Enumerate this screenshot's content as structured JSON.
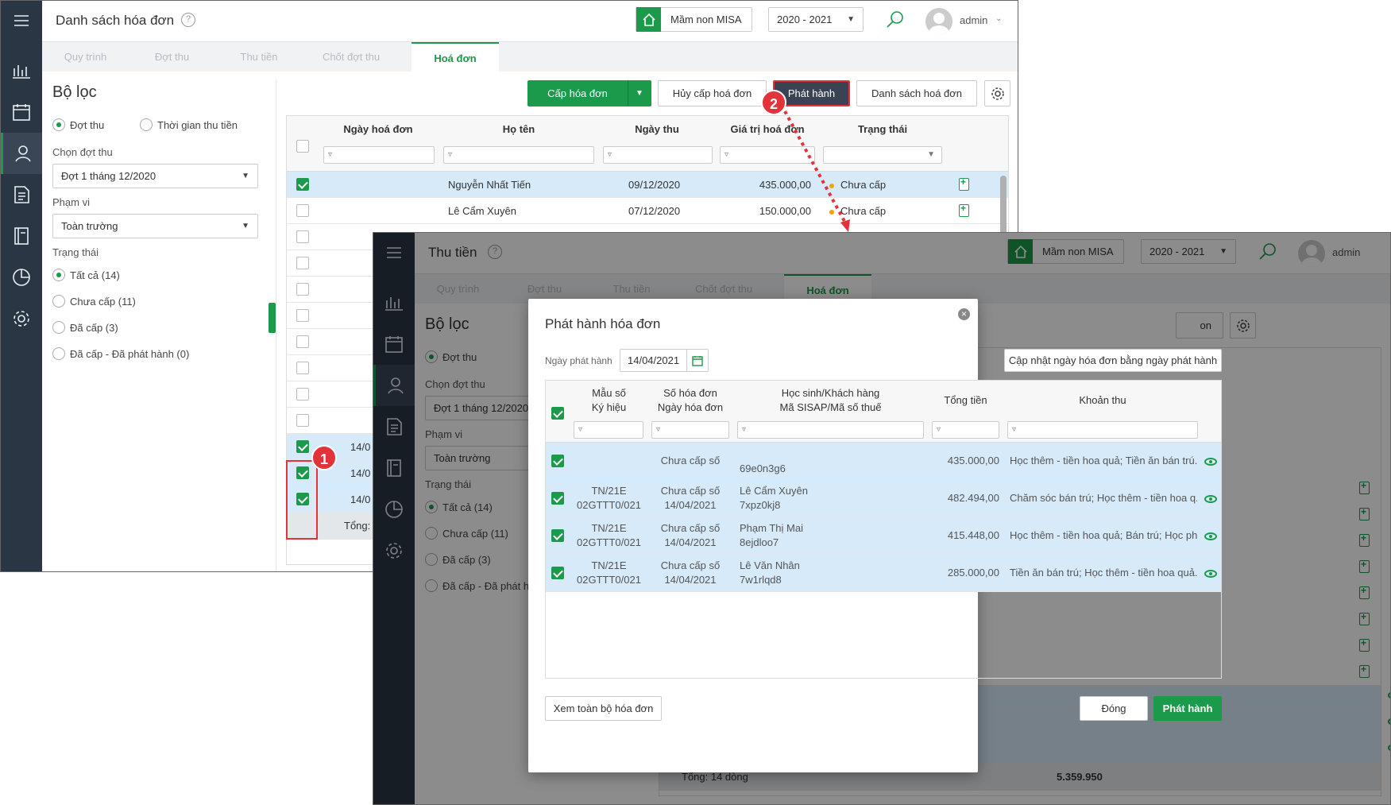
{
  "main_window": {
    "title": "Danh sách hóa đơn",
    "help": "?",
    "school": "Mầm non MISA",
    "year": "2020 - 2021",
    "user": "admin",
    "tabs": [
      "Quy trình",
      "Đợt thu",
      "Thu tiền",
      "Chốt đợt thu",
      "Hoá đơn"
    ],
    "filter": {
      "title": "Bộ lọc",
      "mode_options": [
        "Đợt thu",
        "Thời gian thu tiền"
      ],
      "period_label": "Chọn đợt thu",
      "period_value": "Đợt 1 tháng 12/2020",
      "scope_label": "Phạm vi",
      "scope_value": "Toàn trường",
      "status_label": "Trạng thái",
      "status_options": [
        "Tất cả (14)",
        "Chưa cấp (11)",
        "Đã cấp (3)",
        "Đã cấp - Đã phát hành (0)"
      ]
    },
    "toolbar": {
      "issue": "Cấp hóa đơn",
      "cancel_issue": "Hủy cấp hoá đơn",
      "publish": "Phát hành",
      "invoice_list": "Danh sách hoá đơn"
    },
    "table": {
      "columns": [
        "Ngày hoá đơn",
        "Họ tên",
        "Ngày thu",
        "Giá trị hoá đơn",
        "Trạng thái"
      ],
      "rows": [
        {
          "name": "Nguyễn Nhất Tiến",
          "date": "09/12/2020",
          "amount": "435.000,00",
          "status": "Chưa cấp"
        },
        {
          "name": "Lê Cẩm Xuyên",
          "date": "07/12/2020",
          "amount": "150.000,00",
          "status": "Chưa cấp"
        }
      ],
      "partial_dates": [
        "14/0",
        "14/0",
        "14/0"
      ],
      "total_label": "Tổng:"
    },
    "steps": [
      "1",
      "2"
    ]
  },
  "second_window": {
    "title": "Thu tiền",
    "help": "?",
    "school": "Mầm non MISA",
    "year": "2020 - 2021",
    "user": "admin",
    "tabs": [
      "Quy trình",
      "Đợt thu",
      "Thu tiền",
      "Chốt đợt thu",
      "Hoá đơn"
    ],
    "filter": {
      "title": "Bộ lọc",
      "mode_option": "Đợt thu",
      "period_label": "Chọn đợt thu",
      "period_value": "Đợt 1 tháng 12/2020",
      "scope_label": "Phạm vi",
      "scope_value": "Toàn trường",
      "status_label": "Trạng thái",
      "status_options": [
        "Tất cả (14)",
        "Chưa cấp (11)",
        "Đã cấp (3)",
        "Đã cấp - Đã phát h"
      ]
    },
    "bg_button_partial": "on",
    "footer_total": "Tổng: 14 dòng",
    "footer_amount": "5.359.950"
  },
  "modal": {
    "title": "Phát hành hóa đơn",
    "close": "×",
    "date_label": "Ngày phát hành",
    "date_value": "14/04/2021",
    "update_button": "Cập nhật ngày hóa đơn bằng ngày phát hành",
    "headers": {
      "template": "Mẫu số",
      "symbol": "Ký hiệu",
      "number": "Số hóa đơn",
      "invoice_date": "Ngày hóa đơn",
      "student": "Học sinh/Khách hàng",
      "student_sub": "Mã SISAP/Mã số thuế",
      "total": "Tổng tiền",
      "fees": "Khoản thu"
    },
    "rows": [
      {
        "template": "",
        "symbol": "",
        "number": "Chưa cấp số",
        "date": "",
        "name": "",
        "code": "69e0n3g6",
        "total": "435.000,00",
        "fees": "Học thêm - tiền hoa quả; Tiền ăn bán trú..."
      },
      {
        "template": "TN/21E",
        "symbol": "02GTTT0/021",
        "number": "Chưa cấp số",
        "date": "14/04/2021",
        "name": "Lê Cẩm Xuyên",
        "code": "7xpz0kj8",
        "total": "482.494,00",
        "fees": "Chăm sóc bán trú; Học thêm - tiền hoa q..."
      },
      {
        "template": "TN/21E",
        "symbol": "02GTTT0/021",
        "number": "Chưa cấp số",
        "date": "14/04/2021",
        "name": "Phạm Thị Mai",
        "code": "8ejdloo7",
        "total": "415.448,00",
        "fees": "Học thêm - tiền hoa quả; Bán trú; Học ph..."
      },
      {
        "template": "TN/21E",
        "symbol": "02GTTT0/021",
        "number": "Chưa cấp số",
        "date": "14/04/2021",
        "name": "Lê Văn Nhân",
        "code": "7w1rlqd8",
        "total": "285.000,00",
        "fees": "Tiền ăn bán trú; Học thêm - tiền hoa quả..."
      }
    ],
    "view_all": "Xem toàn bộ hóa đơn",
    "close_button": "Đóng",
    "publish_button": "Phát hành"
  },
  "colors": {
    "accent": "#1a9a4a",
    "sidebar": "#2b3644",
    "selected_row": "#d6eafa",
    "callout": "#e3333a"
  }
}
